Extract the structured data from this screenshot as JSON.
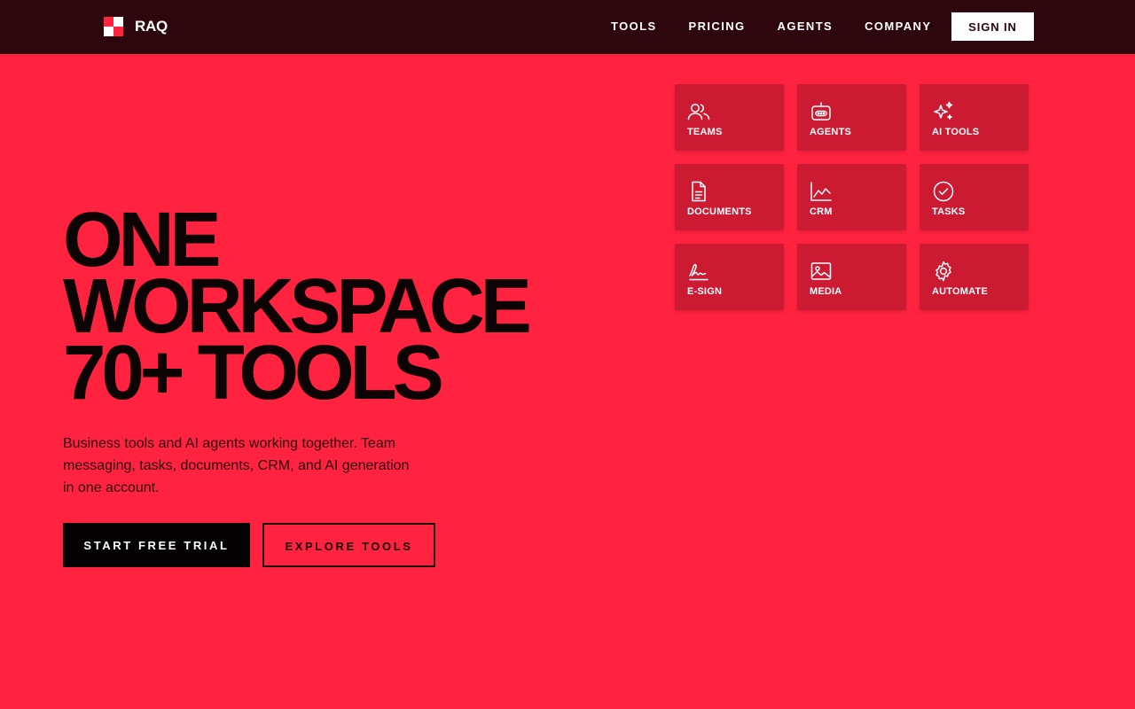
{
  "brand": {
    "name": "RAQ",
    "colors": {
      "accent": "#ff2340",
      "nav_bg": "#2e060e",
      "card": "#cb1a32"
    }
  },
  "nav": {
    "links": [
      "TOOLS",
      "PRICING",
      "AGENTS",
      "COMPANY"
    ],
    "signin_label": "SIGN IN"
  },
  "hero": {
    "title_lines": [
      "ONE",
      "WORKSPACE",
      "70+ TOOLS"
    ],
    "subtitle": "Business tools and AI agents working together. Team messaging, tasks, documents, CRM, and AI generation in one account.",
    "primary_cta": "START FREE TRIAL",
    "secondary_cta": "EXPLORE TOOLS"
  },
  "tools": [
    {
      "label": "TEAMS",
      "icon": "users-icon"
    },
    {
      "label": "AGENTS",
      "icon": "robot-icon"
    },
    {
      "label": "AI TOOLS",
      "icon": "sparkles-icon"
    },
    {
      "label": "DOCUMENTS",
      "icon": "document-icon"
    },
    {
      "label": "CRM",
      "icon": "chart-line-icon"
    },
    {
      "label": "TASKS",
      "icon": "check-circle-icon"
    },
    {
      "label": "E-SIGN",
      "icon": "signature-icon"
    },
    {
      "label": "MEDIA",
      "icon": "image-icon"
    },
    {
      "label": "AUTOMATE",
      "icon": "gear-icon"
    }
  ]
}
